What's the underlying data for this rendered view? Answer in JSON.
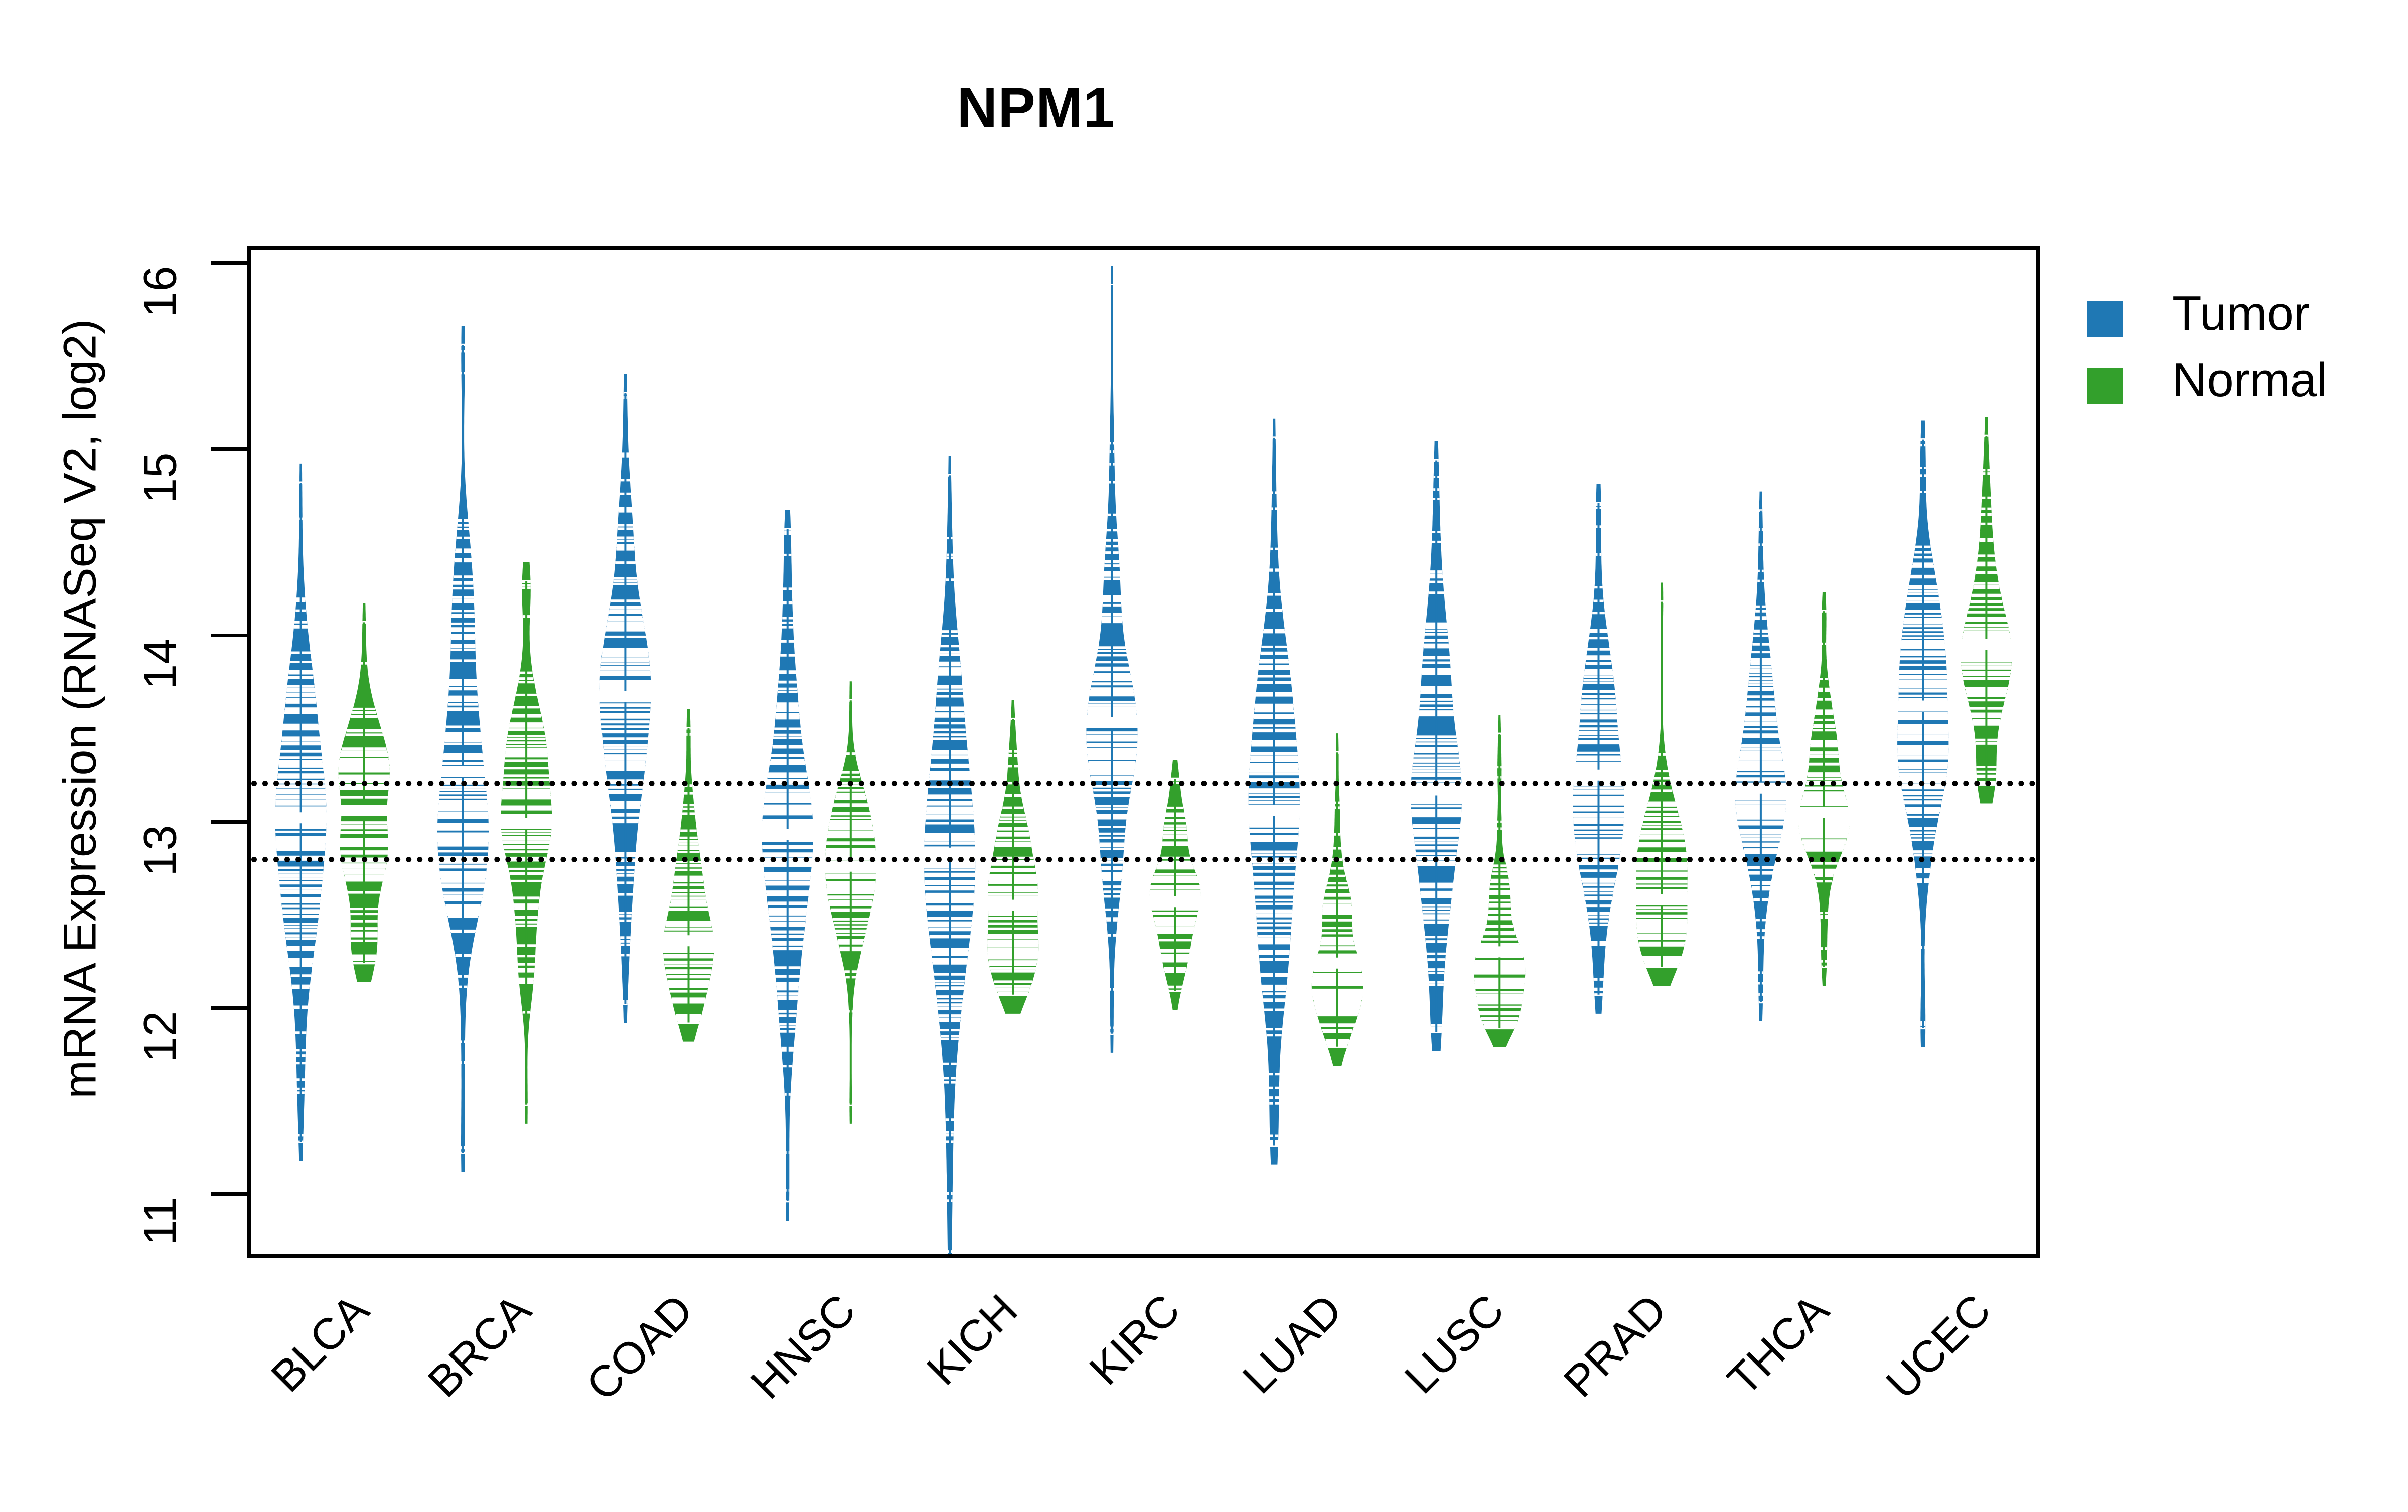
{
  "chart_data": {
    "type": "bar",
    "plot_style": "beanplot (split violin density with individual-value strip lines)",
    "title": "NPM1",
    "xlabel": "",
    "ylabel": "mRNA Expression (RNASeq V2, log2)",
    "ylim": [
      10.6,
      16.1
    ],
    "yticks": [
      11,
      12,
      13,
      14,
      15,
      16
    ],
    "ytick_labels": [
      "11",
      "12",
      "13",
      "14",
      "15",
      "16"
    ],
    "grid": false,
    "legend_position": "right",
    "categories": [
      "BLCA",
      "BRCA",
      "COAD",
      "HNSC",
      "KICH",
      "KIRC",
      "LUAD",
      "LUSC",
      "PRAD",
      "THCA",
      "UCEC"
    ],
    "reference_lines": [
      13.22,
      12.81
    ],
    "colors": {
      "tumor": "#1f78b4",
      "normal": "#33a02c",
      "reference_line": "#000000",
      "frame": "#000000"
    },
    "series": [
      {
        "name": "Tumor",
        "color": "#1f78b4",
        "median": [
          13.02,
          13.27,
          13.67,
          12.93,
          12.83,
          13.53,
          13.06,
          13.17,
          13.25,
          13.18,
          13.62
        ],
        "min": [
          11.28,
          11.22,
          12.02,
          10.96,
          10.66,
          11.86,
          11.26,
          11.87,
          12.07,
          12.03,
          11.89
        ],
        "max": [
          14.82,
          15.56,
          15.3,
          14.57,
          14.86,
          15.88,
          15.06,
          14.94,
          14.71,
          14.67,
          15.05
        ],
        "q1": [
          12.62,
          12.88,
          13.32,
          12.58,
          12.38,
          13.22,
          12.62,
          12.78,
          12.94,
          12.93,
          13.3
        ],
        "q3": [
          13.42,
          13.66,
          14.02,
          13.3,
          13.3,
          13.92,
          13.5,
          13.56,
          13.58,
          13.52,
          13.98
        ]
      },
      {
        "name": "Normal",
        "color": "#33a02c",
        "median": [
          13.06,
          12.99,
          12.36,
          12.76,
          12.55,
          12.57,
          12.24,
          12.3,
          12.58,
          13.05,
          13.95
        ],
        "min": [
          12.24,
          11.48,
          11.92,
          11.48,
          12.07,
          12.09,
          11.79,
          11.89,
          12.22,
          12.22,
          13.2
        ],
        "max": [
          14.07,
          14.29,
          13.5,
          13.65,
          13.55,
          13.23,
          13.37,
          13.47,
          14.18,
          14.13,
          15.07
        ],
        "q1": [
          12.78,
          12.7,
          12.18,
          12.55,
          12.37,
          12.41,
          12.1,
          12.15,
          12.4,
          12.86,
          13.66
        ],
        "q3": [
          13.3,
          13.25,
          12.62,
          12.99,
          12.78,
          12.76,
          12.46,
          12.49,
          12.83,
          13.24,
          14.16
        ]
      }
    ]
  },
  "legend": {
    "items": [
      {
        "label": "Tumor",
        "color": "#1f78b4"
      },
      {
        "label": "Normal",
        "color": "#33a02c"
      }
    ]
  }
}
